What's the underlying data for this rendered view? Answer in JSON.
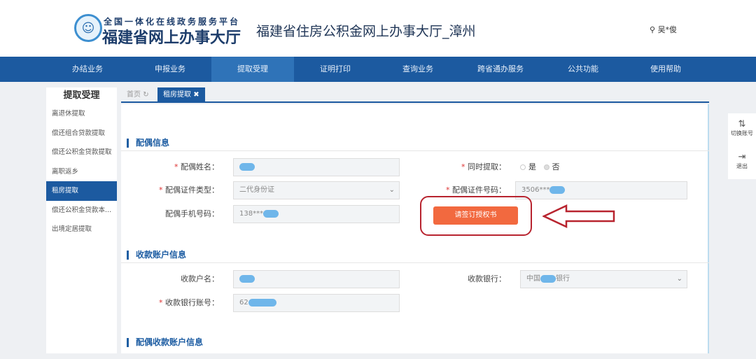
{
  "header": {
    "platform_sub": "全国一体化在线政务服务平台",
    "platform_main": "福建省网上办事大厅",
    "site_title": "福建省住房公积金网上办事大厅_漳州",
    "user": "吴*俊"
  },
  "nav": [
    "办结业务",
    "申报业务",
    "提取受理",
    "证明打印",
    "查询业务",
    "跨省通办服务",
    "公共功能",
    "使用帮助"
  ],
  "sidebar": {
    "title": "提取受理",
    "items": [
      "离退休提取",
      "偿还组合贷款提取",
      "偿还公积金贷款提取",
      "离职返乡",
      "租房提取",
      "偿还公积金贷款本...",
      "出境定居提取"
    ]
  },
  "tabs": {
    "home": "首页",
    "current": "租房提取"
  },
  "spouse": {
    "section": "配偶信息",
    "name_label": "配偶姓名：",
    "id_type_label": "配偶证件类型：",
    "id_type_value": "二代身份证",
    "phone_label": "配偶手机号码：",
    "phone_value": "138***",
    "same_label": "同时提取：",
    "yes": "是",
    "no": "否",
    "id_no_label": "配偶证件号码：",
    "id_no_value": "3506***",
    "sign_button": "请签订授权书"
  },
  "account": {
    "section": "收款账户信息",
    "name_label": "收款户名：",
    "acct_label": "收款银行账号：",
    "acct_value": "62",
    "bank_label": "收款银行：",
    "bank_value_pre": "中国",
    "bank_value_post": "银行"
  },
  "spouse_account": {
    "section": "配偶收款账户信息"
  },
  "right_panel": {
    "switch": "切换账号",
    "logout": "退出"
  }
}
